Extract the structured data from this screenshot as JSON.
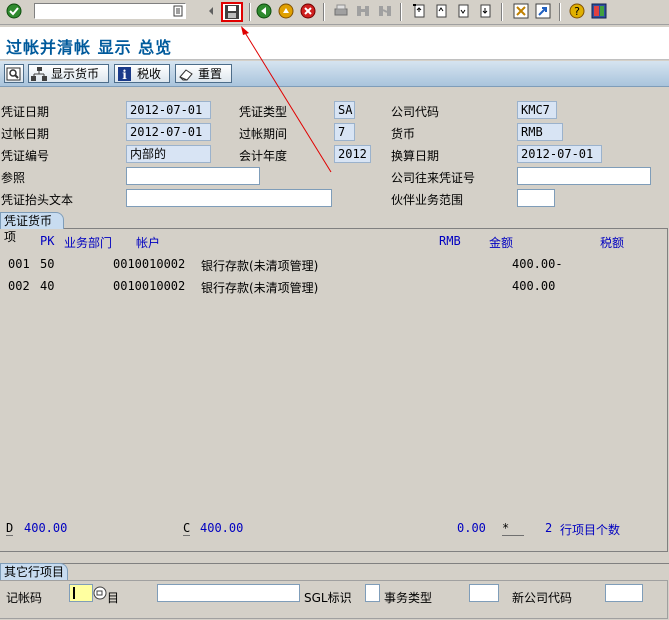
{
  "toolbar": {
    "command_field": "",
    "buttons": [
      "enter-icon",
      "dropdown-icon",
      "back-arrow-icon",
      "save-icon",
      "back-icon",
      "exit-icon",
      "cancel-icon",
      "print-icon",
      "find-icon",
      "find-next-icon",
      "first-page-icon",
      "prev-page-icon",
      "next-page-icon",
      "last-page-icon",
      "new-session-icon",
      "shortcut-icon",
      "help-icon",
      "layout-icon"
    ]
  },
  "title": "过帐并清帐 显示 总览",
  "app_toolbar": {
    "display_currency": "显示货币",
    "tax": "税收",
    "reset": "重置"
  },
  "header": {
    "doc_date_label": "凭证日期",
    "doc_date": "2012-07-01",
    "doc_type_label": "凭证类型",
    "doc_type": "SA",
    "company_code_label": "公司代码",
    "company_code": "KMC7",
    "posting_date_label": "过帐日期",
    "posting_date": "2012-07-01",
    "period_label": "过帐期间",
    "period": "7",
    "currency_label": "货币",
    "currency": "RMB",
    "doc_number_label": "凭证编号",
    "doc_number": "内部的",
    "fiscal_year_label": "会计年度",
    "fiscal_year": "2012",
    "translation_date_label": "换算日期",
    "translation_date": "2012-07-01",
    "reference_label": "参照",
    "reference": "",
    "intercompany_label": "公司往来凭证号",
    "intercompany": "",
    "header_text_label": "凭证抬头文本",
    "header_text": "",
    "partner_ba_label": "伙伴业务范围",
    "partner_ba": ""
  },
  "items": {
    "tab_label": "凭证货币项",
    "col_pk": "PK",
    "col_ba": "业务部门",
    "col_account": "帐户",
    "col_currency": "RMB",
    "col_amount": "金额",
    "col_tax": "税额",
    "rows": [
      {
        "no": "001",
        "pk": "50",
        "account": "0010010002",
        "desc": "银行存款(未清项管理)",
        "amount": "400.00-"
      },
      {
        "no": "002",
        "pk": "40",
        "account": "0010010002",
        "desc": "银行存款(未清项管理)",
        "amount": "400.00"
      }
    ]
  },
  "totals": {
    "debit_label": "D",
    "debit": "400.00",
    "credit_label": "C",
    "credit": "400.00",
    "balance": "0.00",
    "star": "*",
    "count": "2",
    "count_label": "行项目个数"
  },
  "other_line": {
    "tab_label": "其它行项目",
    "posting_key_label": "记帐码",
    "account_label": "目",
    "sgl_label": "SGL标识",
    "trans_type_label": "事务类型",
    "new_cc_label": "新公司代码"
  },
  "colors": {
    "title": "#005a9c",
    "highlight": "#e00000",
    "readonly_field": "#d8e4f4"
  }
}
